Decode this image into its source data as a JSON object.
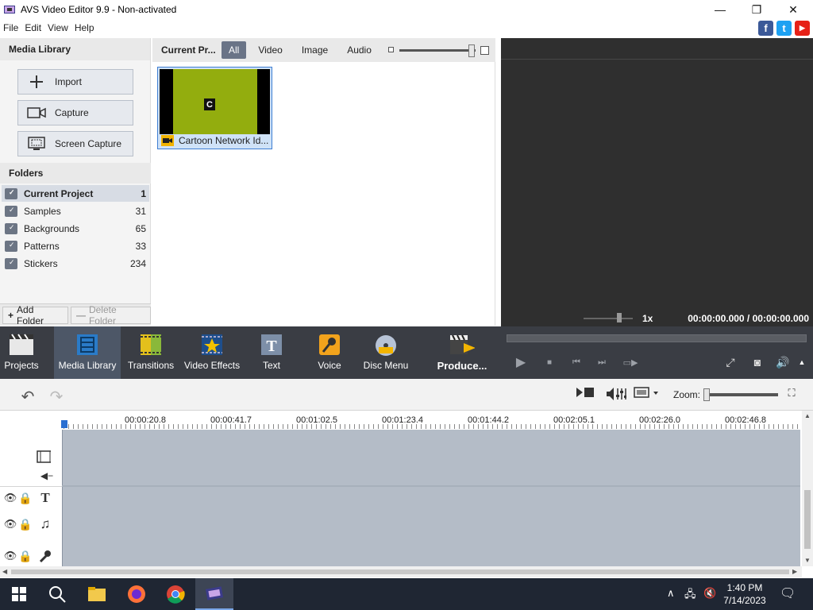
{
  "window": {
    "title": "AVS Video Editor 9.9 - Non-activated",
    "minimize_glyph": "—",
    "maximize_glyph": "❐",
    "close_glyph": "✕"
  },
  "menu": [
    "File",
    "Edit",
    "View",
    "Help"
  ],
  "social": [
    "f",
    "t",
    "▶"
  ],
  "media_library": {
    "header": "Media Library",
    "buttons": [
      "Import",
      "Capture",
      "Screen Capture"
    ]
  },
  "folders": {
    "header": "Folders",
    "items": [
      {
        "name": "Current Project",
        "count": "1"
      },
      {
        "name": "Samples",
        "count": "31"
      },
      {
        "name": "Backgrounds",
        "count": "65"
      },
      {
        "name": "Patterns",
        "count": "33"
      },
      {
        "name": "Stickers",
        "count": "234"
      }
    ],
    "add_label": "Add Folder",
    "delete_label": "Delete Folder"
  },
  "media_top": {
    "current_label": "Current Pr...",
    "filters": [
      "All",
      "Video",
      "Image",
      "Audio"
    ]
  },
  "media_items": [
    {
      "caption": "Cartoon Network Id...",
      "thumb_letter": "C"
    }
  ],
  "preview": {
    "speed": "1x",
    "timecode": "00:00:00.000 / 00:00:00.000"
  },
  "toolbar": {
    "tools": [
      "Projects",
      "Media Library",
      "Transitions",
      "Video Effects",
      "Text",
      "Voice",
      "Disc Menu",
      "Produce..."
    ]
  },
  "timeline": {
    "zoom_label": "Zoom:",
    "ruler_labels": [
      "00:00:20.8",
      "00:00:41.7",
      "00:01:02.5",
      "00:01:23.4",
      "00:01:44.2",
      "00:02:05.1",
      "00:02:26.0",
      "00:02:46.8"
    ]
  },
  "taskbar": {
    "time": "1:40 PM",
    "date": "7/14/2023"
  },
  "colors": {
    "accent_blue": "#3e7ed3",
    "toolbar_bg": "#3a3d44",
    "timeline_track": "#b4bcc7",
    "preview_bg": "#2f2f2f"
  }
}
